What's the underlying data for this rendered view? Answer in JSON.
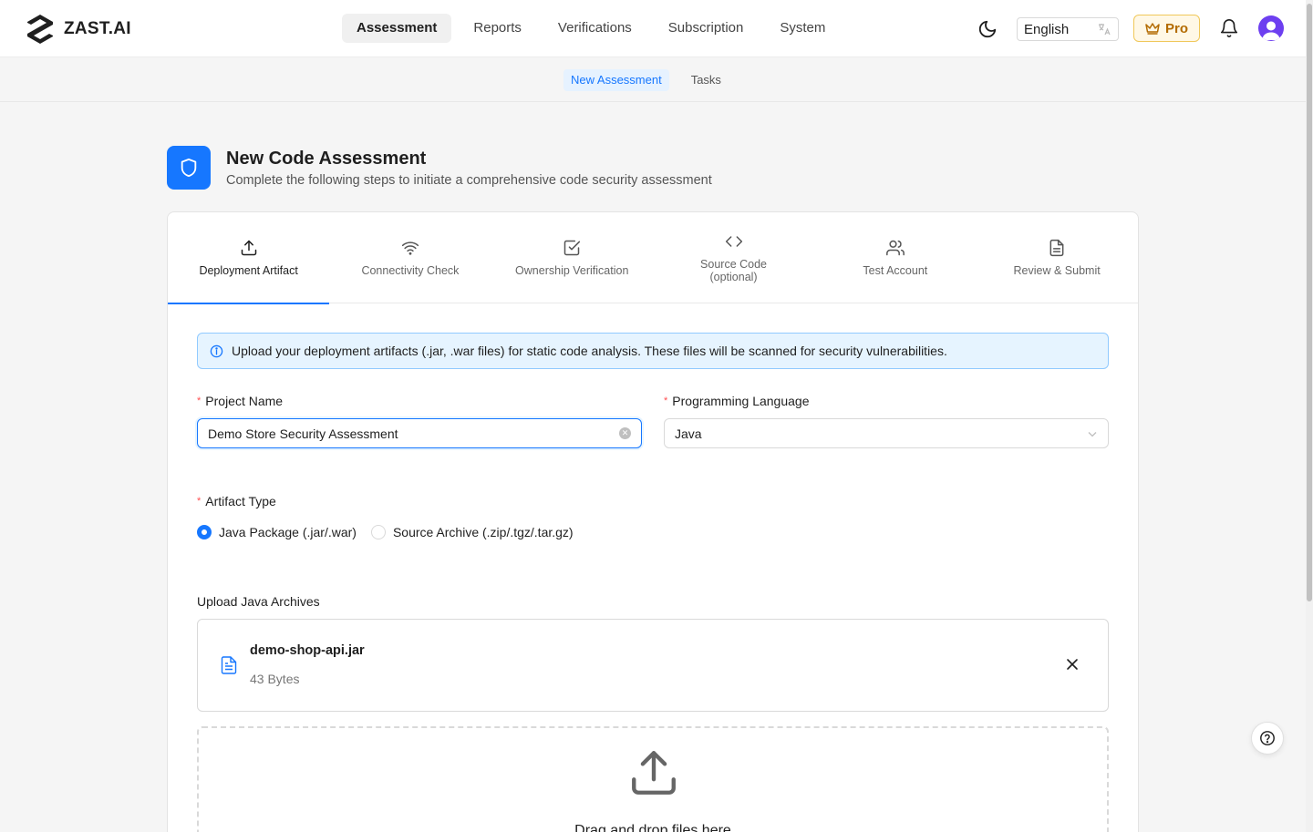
{
  "app": {
    "name": "ZAST.AI"
  },
  "mainnav": [
    {
      "label": "Assessment",
      "active": true
    },
    {
      "label": "Reports"
    },
    {
      "label": "Verifications"
    },
    {
      "label": "Subscription"
    },
    {
      "label": "System"
    }
  ],
  "header": {
    "language": "English",
    "pro_label": "Pro"
  },
  "subnav": [
    {
      "label": "New Assessment",
      "active": true
    },
    {
      "label": "Tasks"
    }
  ],
  "page": {
    "title": "New Code Assessment",
    "subtitle": "Complete the following steps to initiate a comprehensive code security assessment"
  },
  "steps": [
    {
      "label": "Deployment Artifact",
      "icon": "upload-icon",
      "active": true
    },
    {
      "label": "Connectivity Check",
      "icon": "wifi-icon"
    },
    {
      "label": "Ownership Verification",
      "icon": "check-square-icon"
    },
    {
      "label": "Source Code",
      "sub": "(optional)",
      "icon": "code-icon"
    },
    {
      "label": "Test Account",
      "icon": "users-icon"
    },
    {
      "label": "Review & Submit",
      "icon": "document-icon"
    }
  ],
  "alert": {
    "text": "Upload your deployment artifacts (.jar, .war files) for static code analysis. These files will be scanned for security vulnerabilities."
  },
  "form": {
    "project_name_label": "Project Name",
    "project_name_value": "Demo Store Security Assessment",
    "language_label": "Programming Language",
    "language_value": "Java",
    "artifact_type_label": "Artifact Type",
    "artifact_options": [
      {
        "label": "Java Package (.jar/.war)",
        "checked": true
      },
      {
        "label": "Source Archive (.zip/.tgz/.tar.gz)",
        "checked": false
      }
    ],
    "upload_label": "Upload Java Archives"
  },
  "file": {
    "name": "demo-shop-api.jar",
    "size": "43 Bytes"
  },
  "dropzone": {
    "text": "Drag and drop files here"
  },
  "colors": {
    "accent": "#1677ff",
    "pro": "#b36b00",
    "avatar": "#6d3ff0"
  }
}
